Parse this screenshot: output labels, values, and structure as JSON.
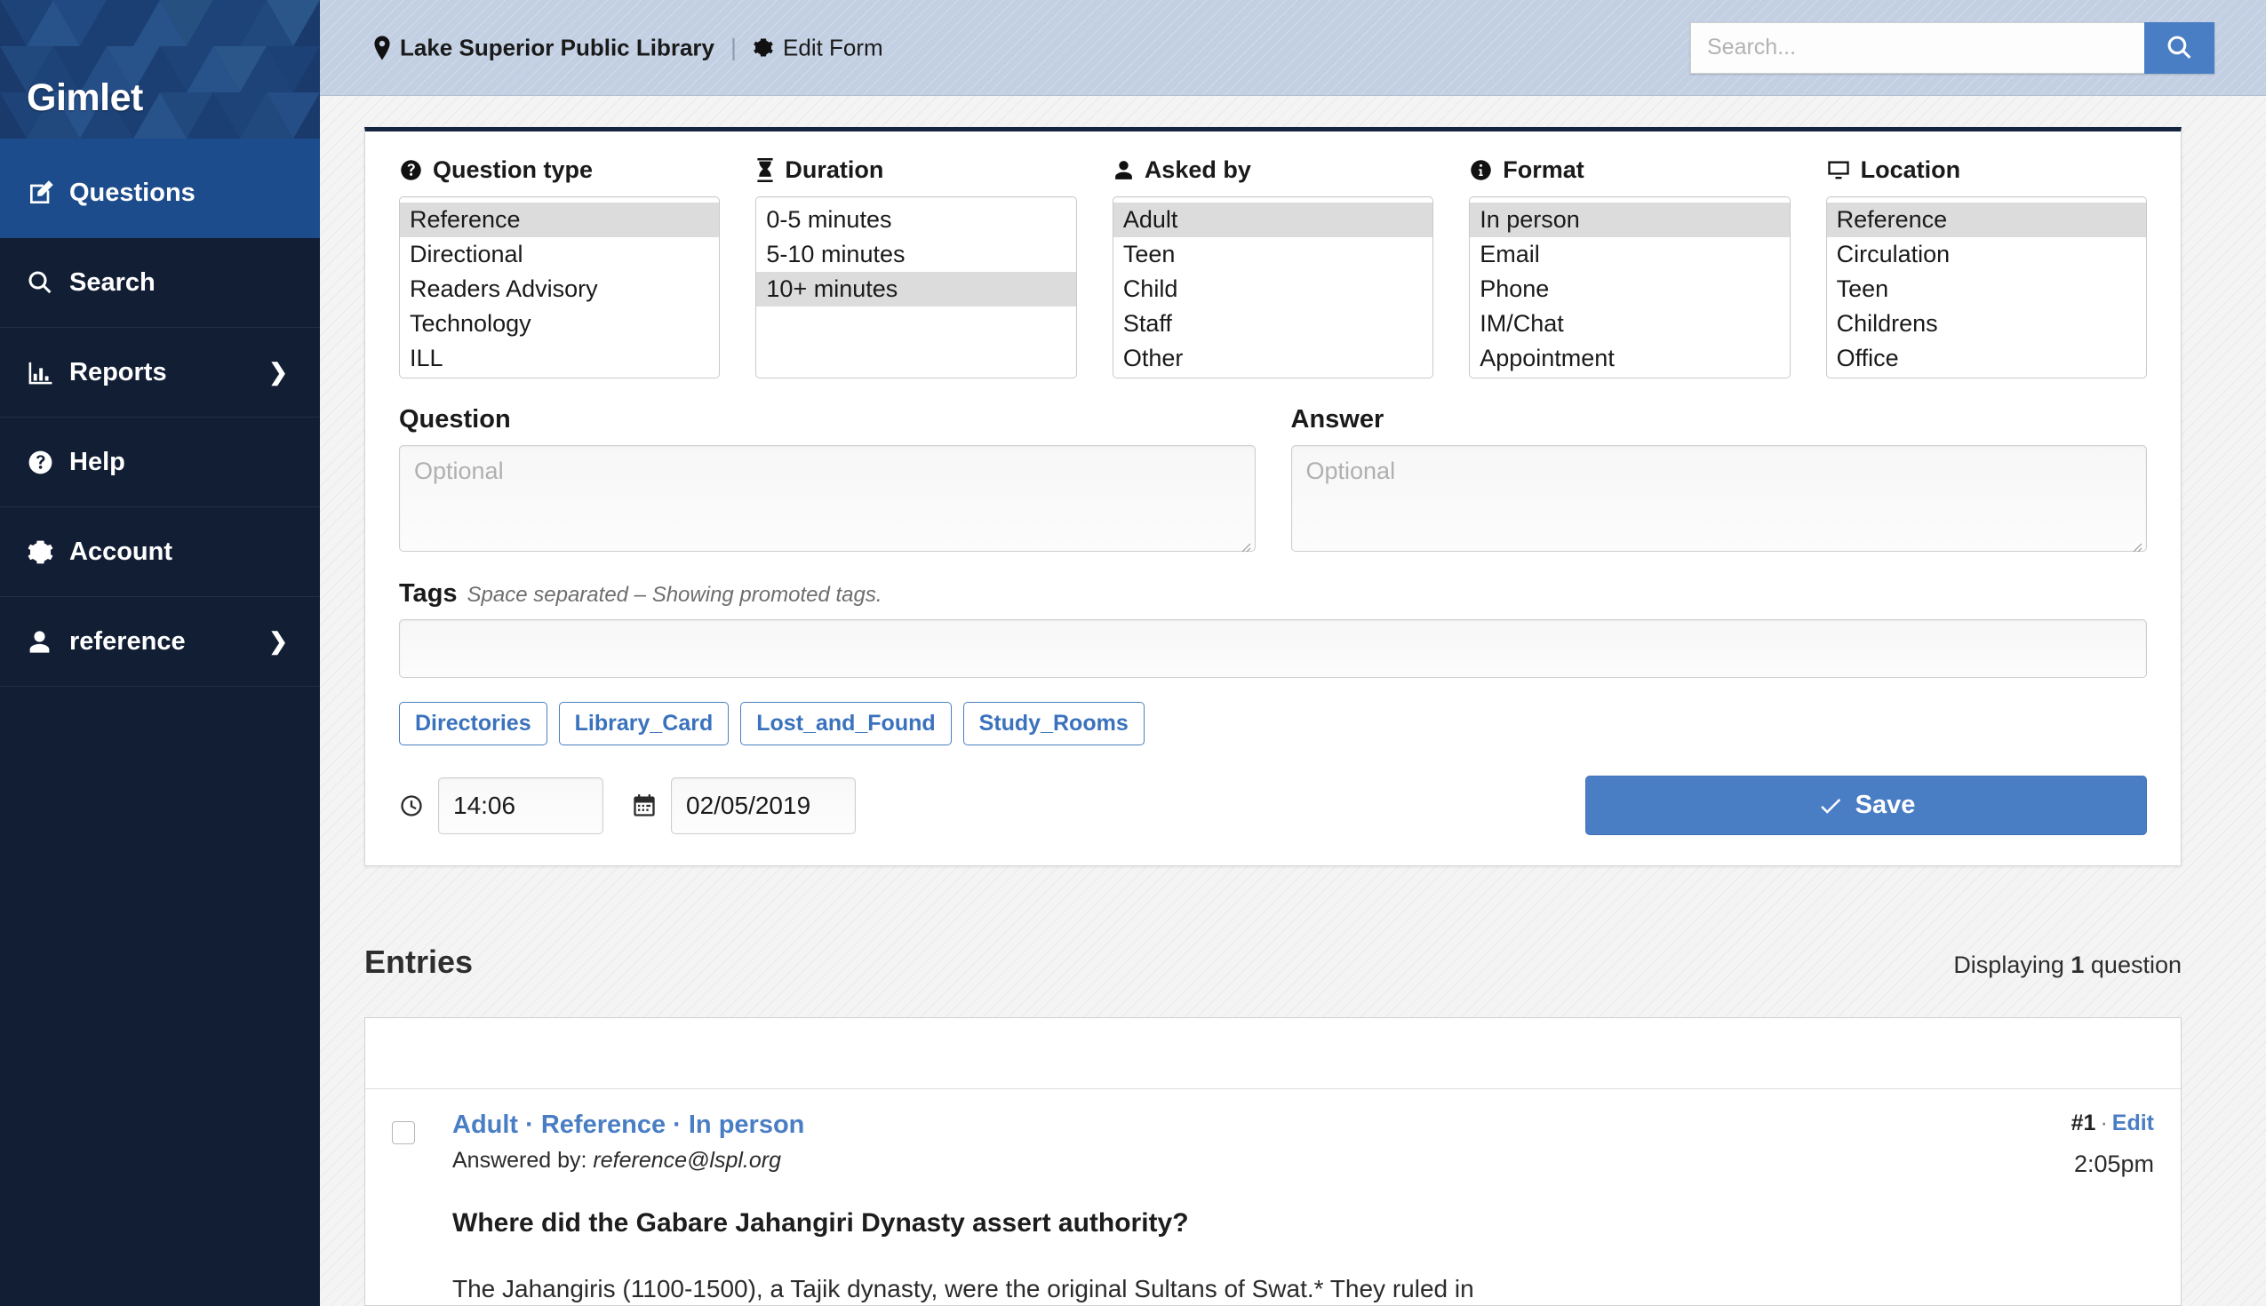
{
  "brand": {
    "name": "Gimlet"
  },
  "sidebar": {
    "items": [
      {
        "label": "Questions",
        "icon": "edit-square-icon",
        "active": true,
        "caret": false
      },
      {
        "label": "Search",
        "icon": "search-icon",
        "active": false,
        "caret": false
      },
      {
        "label": "Reports",
        "icon": "bar-chart-icon",
        "active": false,
        "caret": true
      },
      {
        "label": "Help",
        "icon": "question-circle-icon",
        "active": false,
        "caret": false
      },
      {
        "label": "Account",
        "icon": "gear-icon",
        "active": false,
        "caret": false
      },
      {
        "label": "reference",
        "icon": "user-icon",
        "active": false,
        "caret": true
      }
    ],
    "caret_glyph": "❯"
  },
  "topbar": {
    "library": "Lake Superior Public Library",
    "separator": "|",
    "edit_form": "Edit Form",
    "search": {
      "placeholder": "Search...",
      "value": ""
    }
  },
  "form": {
    "columns": [
      {
        "title": "Question type",
        "icon": "question-circle-icon",
        "options": [
          "Reference",
          "Directional",
          "Readers Advisory",
          "Technology",
          "ILL"
        ],
        "selected": [
          "Reference"
        ]
      },
      {
        "title": "Duration",
        "icon": "hourglass-icon",
        "options": [
          "0-5 minutes",
          "5-10 minutes",
          "10+ minutes"
        ],
        "selected": [
          "10+ minutes"
        ]
      },
      {
        "title": "Asked by",
        "icon": "user-icon",
        "options": [
          "Adult",
          "Teen",
          "Child",
          "Staff",
          "Other"
        ],
        "selected": [
          "Adult"
        ]
      },
      {
        "title": "Format",
        "icon": "info-circle-icon",
        "options": [
          "In person",
          "Email",
          "Phone",
          "IM/Chat",
          "Appointment"
        ],
        "selected": [
          "In person"
        ]
      },
      {
        "title": "Location",
        "icon": "monitor-icon",
        "options": [
          "Reference",
          "Circulation",
          "Teen",
          "Childrens",
          "Office"
        ],
        "selected": [
          "Reference"
        ]
      }
    ],
    "question": {
      "label": "Question",
      "placeholder": "Optional",
      "value": ""
    },
    "answer": {
      "label": "Answer",
      "placeholder": "Optional",
      "value": ""
    },
    "tags": {
      "label": "Tags",
      "hint": "Space separated – Showing promoted tags.",
      "value": "",
      "promoted": [
        "Directories",
        "Library_Card",
        "Lost_and_Found",
        "Study_Rooms"
      ]
    },
    "time": {
      "icon": "clock-icon",
      "value": "14:06"
    },
    "date": {
      "icon": "calendar-icon",
      "value": "02/05/2019"
    },
    "save": {
      "label": "Save",
      "icon": "check-icon",
      "color": "#4a7ec4"
    }
  },
  "entries": {
    "title": "Entries",
    "count_prefix": "Displaying ",
    "count_value": "1",
    "count_suffix": " question",
    "rows": [
      {
        "meta": "Adult · Reference · In person",
        "answered_by_label": "Answered by: ",
        "answered_by": "reference@lspl.org",
        "question": "Where did the Gabare Jahangiri Dynasty assert authority?",
        "answer": "The Jahangiris (1100-1500), a Tajik dynasty, were the original Sultans of Swat.* They ruled in",
        "id": "#1",
        "id_sep": "·",
        "edit": "Edit",
        "time": "2:05pm"
      }
    ]
  },
  "colors": {
    "sidebar_bg": "#111e34",
    "sidebar_active": "#1c4c8c",
    "accent": "#4a7ec4",
    "topbar_bg": "#c3d0e3",
    "panel_top_border": "#15253f"
  }
}
